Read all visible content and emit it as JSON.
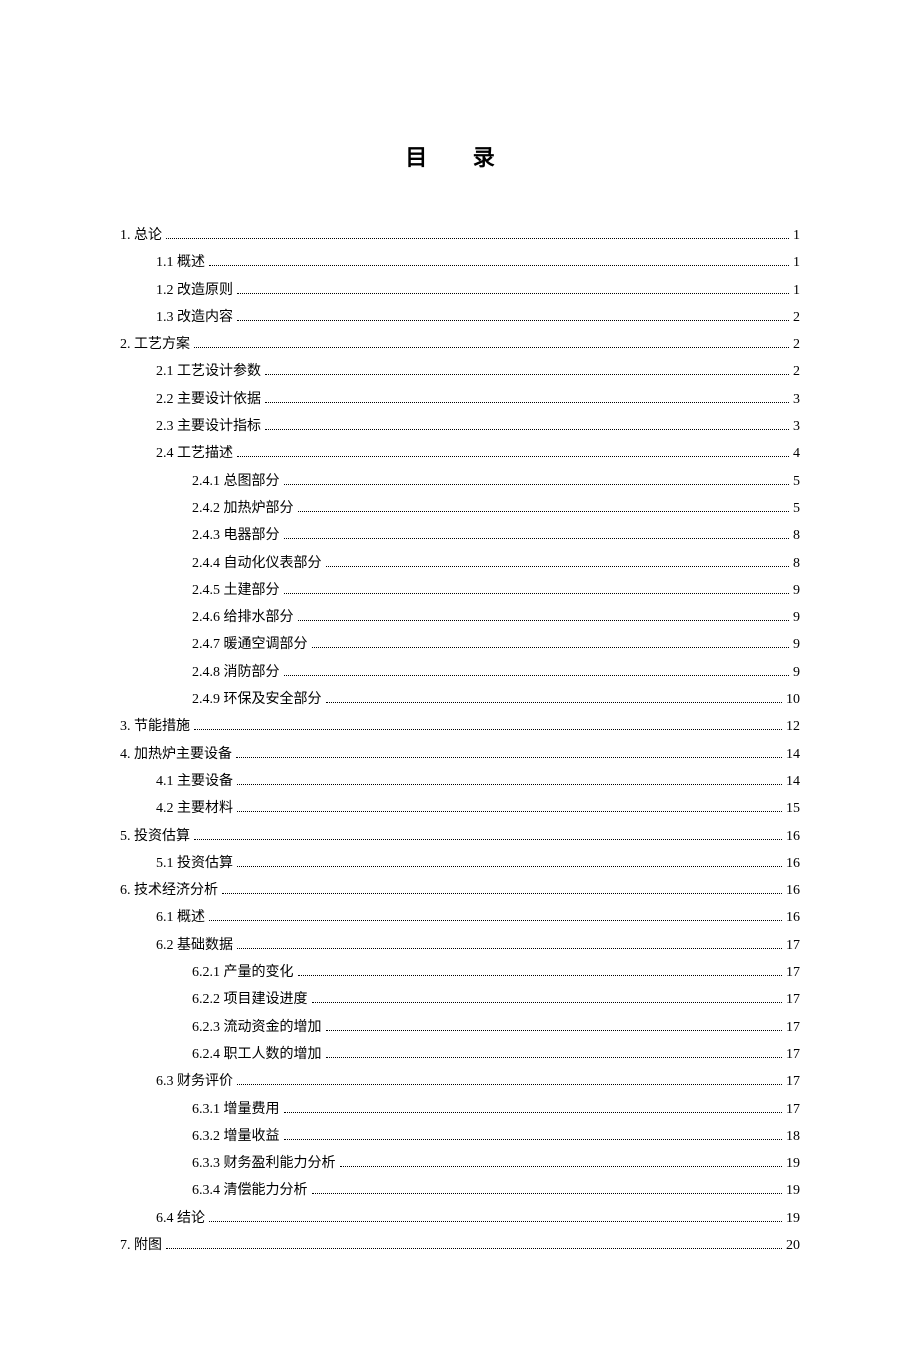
{
  "title": "目 录",
  "toc": [
    {
      "level": 0,
      "label": "1.  总论",
      "page": "1"
    },
    {
      "level": 1,
      "label": "1.1 概述",
      "page": "1"
    },
    {
      "level": 1,
      "label": "1.2 改造原则",
      "page": "1"
    },
    {
      "level": 1,
      "label": "1.3 改造内容",
      "page": "2"
    },
    {
      "level": 0,
      "label": "2. 工艺方案",
      "page": "2"
    },
    {
      "level": 1,
      "label": "2.1 工艺设计参数",
      "page": "2"
    },
    {
      "level": 1,
      "label": "2.2 主要设计依据",
      "page": "3"
    },
    {
      "level": 1,
      "label": "2.3 主要设计指标",
      "page": "3"
    },
    {
      "level": 1,
      "label": "2.4 工艺描述",
      "page": "4"
    },
    {
      "level": 2,
      "label": "2.4.1 总图部分",
      "page": "5"
    },
    {
      "level": 2,
      "label": "2.4.2 加热炉部分",
      "page": "5"
    },
    {
      "level": 2,
      "label": "2.4.3 电器部分",
      "page": "8"
    },
    {
      "level": 2,
      "label": "2.4.4 自动化仪表部分",
      "page": "8"
    },
    {
      "level": 2,
      "label": "2.4.5 土建部分",
      "page": "9"
    },
    {
      "level": 2,
      "label": "2.4.6 给排水部分",
      "page": "9"
    },
    {
      "level": 2,
      "label": "2.4.7 暖通空调部分",
      "page": "9"
    },
    {
      "level": 2,
      "label": "2.4.8 消防部分",
      "page": "9"
    },
    {
      "level": 2,
      "label": "2.4.9 环保及安全部分",
      "page": "10"
    },
    {
      "level": 0,
      "label": "3. 节能措施",
      "page": "12"
    },
    {
      "level": 0,
      "label": "4. 加热炉主要设备",
      "page": "14"
    },
    {
      "level": 1,
      "label": "4.1 主要设备",
      "page": "14"
    },
    {
      "level": 1,
      "label": "4.2 主要材料",
      "page": "15"
    },
    {
      "level": 0,
      "label": "5. 投资估算",
      "page": "16"
    },
    {
      "level": 1,
      "label": "5.1 投资估算",
      "page": "16"
    },
    {
      "level": 0,
      "label": "6. 技术经济分析",
      "page": "16"
    },
    {
      "level": 1,
      "label": "6.1 概述",
      "page": "16"
    },
    {
      "level": 1,
      "label": "6.2 基础数据",
      "page": "17"
    },
    {
      "level": 2,
      "label": "6.2.1 产量的变化",
      "page": "17"
    },
    {
      "level": 2,
      "label": "6.2.2   项目建设进度",
      "page": "17"
    },
    {
      "level": 2,
      "label": "6.2.3   流动资金的增加",
      "page": "17"
    },
    {
      "level": 2,
      "label": "6.2.4   职工人数的增加",
      "page": "17"
    },
    {
      "level": 1,
      "label": "6.3 财务评价",
      "page": "17"
    },
    {
      "level": 2,
      "label": "6.3.1   增量费用",
      "page": "17"
    },
    {
      "level": 2,
      "label": "6.3.2   增量收益",
      "page": "18"
    },
    {
      "level": 2,
      "label": "6.3.3   财务盈利能力分析",
      "page": "19"
    },
    {
      "level": 2,
      "label": "6.3.4   清偿能力分析",
      "page": "19"
    },
    {
      "level": 1,
      "label": "6.4 结论",
      "page": "19"
    },
    {
      "level": 0,
      "label": "7. 附图",
      "page": "20"
    }
  ]
}
